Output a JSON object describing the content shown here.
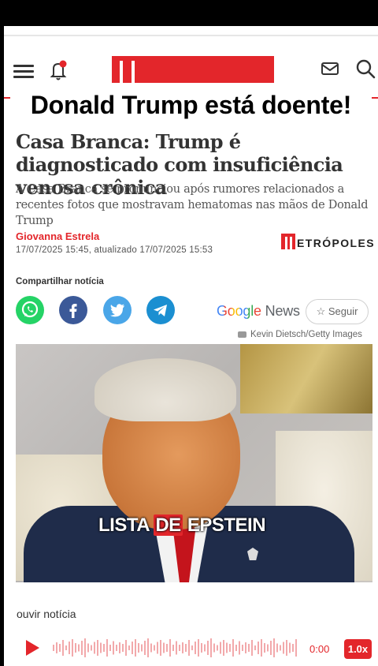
{
  "overlay_title": "Donald Trump está doente!",
  "article": {
    "title": "Casa Branca: Trump é diagnosticado com insuficiência venosa crônica",
    "description": "A Casa Branca se pronunciou após rumores relacionados a recentes fotos que mostravam hematomas nas mãos de Donald Trump",
    "author": "Giovanna Estrela",
    "dates": "17/07/2025 15:45, atualizado 17/07/2025 15:53",
    "brand": "ETRÓPOLES"
  },
  "share": {
    "label": "Compartilhar notícia",
    "buttons": [
      {
        "name": "whatsapp",
        "color": "#25d366"
      },
      {
        "name": "facebook",
        "color": "#3b5998"
      },
      {
        "name": "twitter",
        "color": "#4aa6e8"
      },
      {
        "name": "telegram",
        "color": "#1b8fd1"
      }
    ]
  },
  "google_news": {
    "google": "Google",
    "news": " News",
    "follow_label": "☆ Seguir"
  },
  "photo": {
    "credit": "Kevin Dietsch/Getty Images",
    "caption_a": "LISTA ",
    "caption_b": "DE",
    "caption_c": " EPSTEIN"
  },
  "audio": {
    "label": "ouvir notícia",
    "time": "0:00",
    "speed": "1.0x"
  },
  "colors": {
    "accent": "#e3262b",
    "text": "#333333"
  }
}
